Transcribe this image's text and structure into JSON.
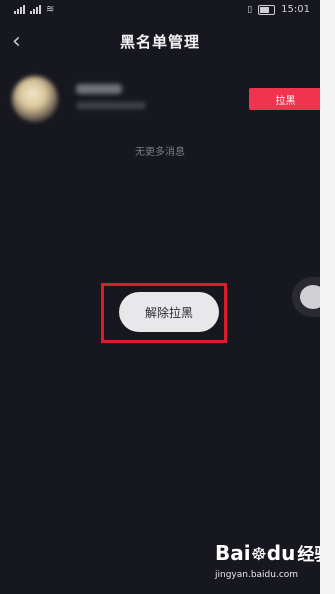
{
  "status_bar": {
    "time": "15:01",
    "icons": [
      "sim-signal-icon",
      "sim-signal-icon",
      "wifi-icon",
      "vibrate-icon",
      "battery-icon"
    ]
  },
  "header": {
    "back_icon": "chevron-left-icon",
    "title": "黑名单管理"
  },
  "blocked_list": {
    "items": [
      {
        "block_label": "拉黑"
      }
    ],
    "end_text": "无更多消息"
  },
  "popup": {
    "unblock_label": "解除拉黑"
  },
  "watermark": {
    "logo": "Bai经验",
    "logo_paw": "☸",
    "logo_du": "du",
    "url": "jingyan.baidu.com"
  },
  "colors": {
    "background": "#17171f",
    "accent": "#f0334f",
    "highlight": "#d81e2c"
  }
}
